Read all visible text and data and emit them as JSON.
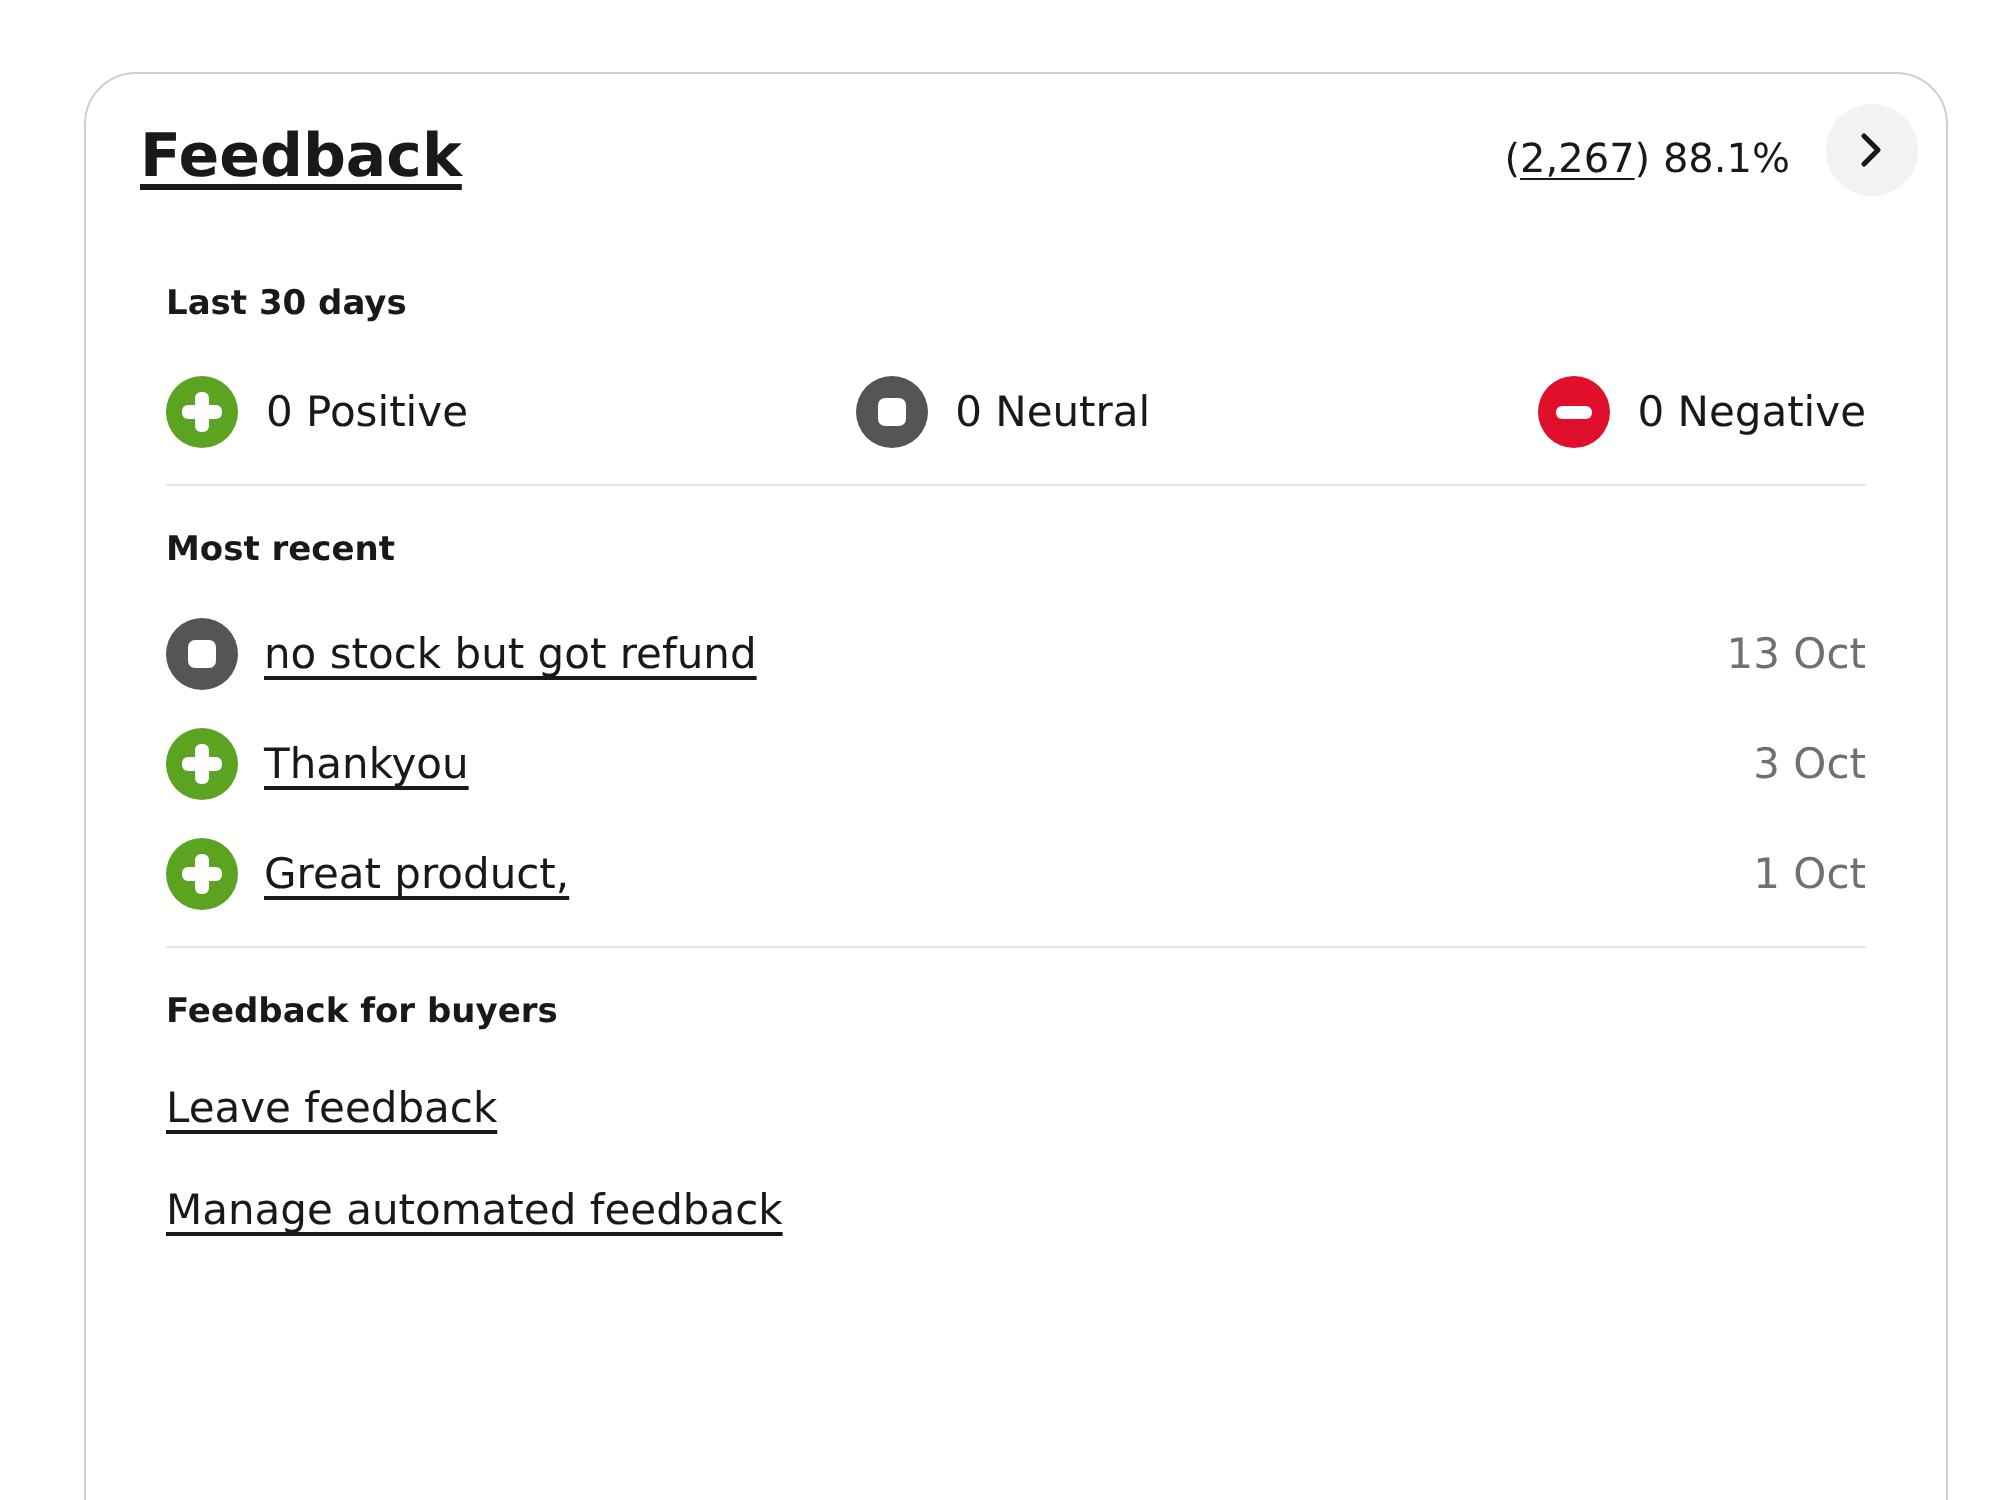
{
  "header": {
    "title": "Feedback",
    "rating": {
      "before": "(",
      "count": "2,267",
      "after": ") 88.1%"
    }
  },
  "last_30_days": {
    "heading": "Last 30 days",
    "totals": [
      {
        "kind": "positive",
        "label": "0 Positive"
      },
      {
        "kind": "neutral",
        "label": "0 Neutral"
      },
      {
        "kind": "negative",
        "label": "0 Negative"
      }
    ]
  },
  "most_recent": {
    "heading": "Most recent",
    "items": [
      {
        "kind": "neutral",
        "comment": "no stock but got refund",
        "date": "13 Oct"
      },
      {
        "kind": "positive",
        "comment": "Thankyou",
        "date": "3 Oct"
      },
      {
        "kind": "positive",
        "comment": "Great product,",
        "date": "1 Oct"
      }
    ]
  },
  "buyers": {
    "heading": "Feedback for buyers",
    "links": [
      "Leave feedback",
      "Manage automated feedback"
    ]
  }
}
